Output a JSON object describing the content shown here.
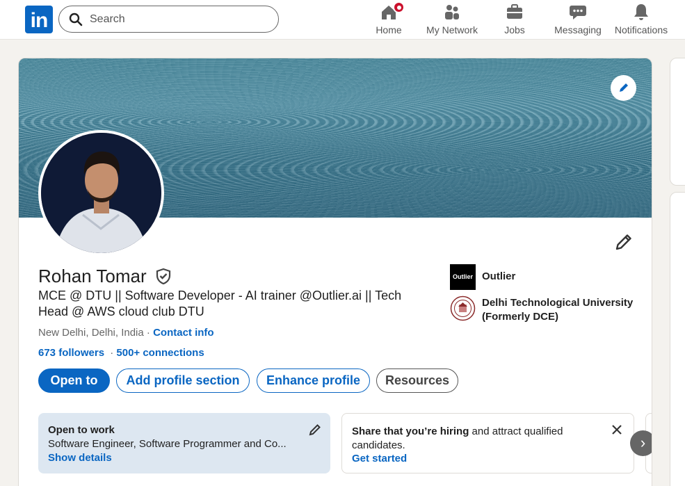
{
  "nav": {
    "logo_text": "in",
    "search_placeholder": "Search",
    "items": [
      {
        "label": "Home",
        "icon": "home-icon"
      },
      {
        "label": "My Network",
        "icon": "network-icon"
      },
      {
        "label": "Jobs",
        "icon": "briefcase-icon"
      },
      {
        "label": "Messaging",
        "icon": "messaging-icon"
      },
      {
        "label": "Notifications",
        "icon": "bell-icon"
      }
    ]
  },
  "profile": {
    "name": "Rohan Tomar",
    "headline": "MCE @ DTU || Software Developer - AI trainer @Outlier.ai || Tech Head @ AWS cloud club DTU",
    "location": "New Delhi, Delhi, India",
    "separator": " · ",
    "contact_label": "Contact info",
    "followers": "673 followers",
    "connections": "500+ connections",
    "stats_separator": " · ",
    "organizations": [
      {
        "name": "Outlier",
        "logo_text": "Outlier"
      },
      {
        "name": "Delhi Technological University (Formerly DCE)",
        "logo_text": ""
      }
    ]
  },
  "actions": {
    "open_to": "Open to",
    "add_section": "Add profile section",
    "enhance": "Enhance profile",
    "resources": "Resources"
  },
  "open_to_work": {
    "title": "Open to work",
    "detail": "Software Engineer, Software Programmer and Co...",
    "link": "Show details"
  },
  "hiring": {
    "bold": "Share that you’re hiring",
    "rest": " and attract qualified candidates.",
    "link": "Get started"
  },
  "colors": {
    "brand": "#0a66c2",
    "badge": "#cb112d",
    "open_to_work_bg": "#dde7f1"
  }
}
